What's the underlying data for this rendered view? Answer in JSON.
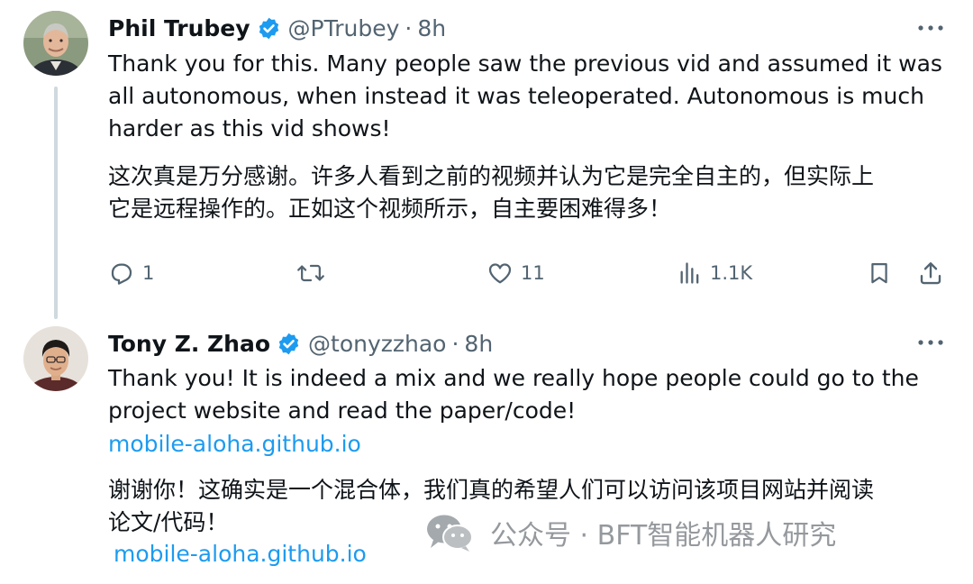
{
  "tweets": [
    {
      "display_name": "Phil Trubey",
      "handle": "@PTrubey",
      "separator": "·",
      "time": "8h",
      "text_en": "Thank you for this. Many people saw the previous vid and assumed it was\nall autonomous, when instead it was teleoperated. Autonomous is much\nharder as this vid shows!",
      "text_cn": "这次真是万分感谢。许多人看到之前的视频并认为它是完全自主的，但实际上\n它是远程操作的。正如这个视频所示，自主要困难得多！",
      "actions": {
        "reply_count": "1",
        "like_count": "11",
        "views_count": "1.1K"
      },
      "icons": [
        "reply-icon",
        "retweet-icon",
        "like-icon",
        "views-icon",
        "bookmark-icon",
        "share-icon"
      ]
    },
    {
      "display_name": "Tony Z. Zhao",
      "handle": "@tonyzzhao",
      "separator": "·",
      "time": "8h",
      "text_en": "Thank you! It is indeed a mix and we really hope people could go to the\nproject website and read the paper/code!",
      "link_en": "mobile-aloha.github.io",
      "text_cn": "谢谢你！这确实是一个混合体，我们真的希望人们可以访问该项目网站并阅读\n论文/代码！",
      "link_cn": "mobile-aloha.github.io"
    }
  ],
  "watermark": {
    "text": "公众号 · BFT智能机器人研究",
    "icon": "wechat-icon"
  },
  "colors": {
    "text": "#0f1419",
    "secondary": "#536471",
    "link": "#1d9bf0",
    "verified": "#1d9bf0",
    "thread_line": "#cfd9de"
  }
}
